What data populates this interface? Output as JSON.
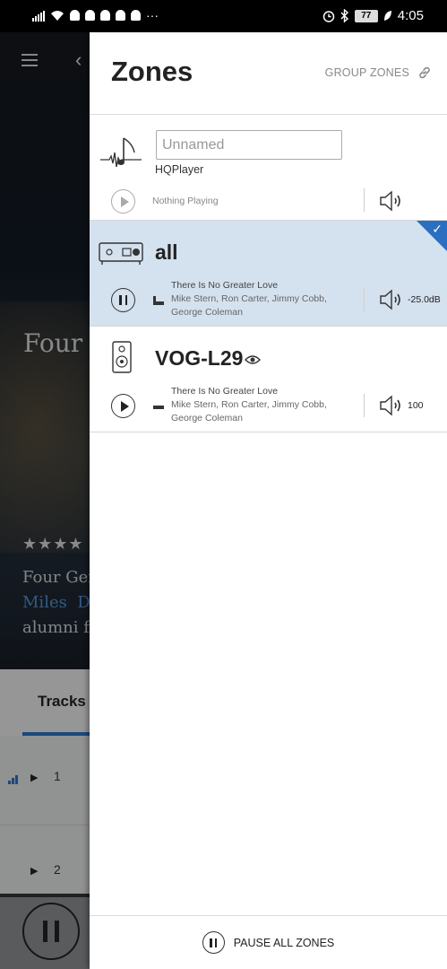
{
  "status_bar": {
    "time": "4:05",
    "battery": "77",
    "more_indicator": "···"
  },
  "background": {
    "title": "Four G",
    "rating_stars": "★★★★",
    "desc_line1": "Four Ger",
    "desc_link1": "Miles",
    "desc_link2": "D",
    "desc_line3": "alumni f",
    "tab_label": "Tracks",
    "tracks": [
      {
        "number": "1"
      },
      {
        "number": "2"
      }
    ]
  },
  "drawer": {
    "title": "Zones",
    "group_zones_label": "GROUP ZONES",
    "zones": [
      {
        "name_placeholder": "Unnamed",
        "subtitle": "HQPlayer",
        "now_playing": "Nothing Playing",
        "icon": "music-note-waveform-icon",
        "transport": "play",
        "volume": ""
      },
      {
        "name": "all",
        "title": "There Is No Greater Love",
        "artists_line1": "Mike Stern, Ron Carter, Jimmy Cobb,",
        "artists_line2": "George Coleman",
        "icon": "amplifier-icon",
        "transport": "pause",
        "volume": "-25.0dB",
        "selected": true
      },
      {
        "name": "VOG-L29",
        "title": "There Is No Greater Love",
        "artists_line1": "Mike Stern, Ron Carter, Jimmy Cobb,",
        "artists_line2": "George Coleman",
        "icon": "speaker-icon",
        "transport": "play",
        "volume": "100"
      }
    ],
    "footer_label": "PAUSE ALL ZONES"
  },
  "colors": {
    "accent": "#2a6fc0",
    "selected_zone_bg": "#d4e1ef"
  }
}
